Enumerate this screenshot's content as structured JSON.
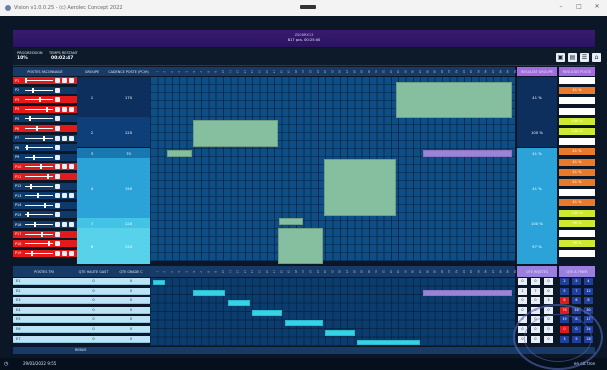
{
  "window": {
    "title": "Vision v1.0.0.25 - (c) Aerolec Concept 2022"
  },
  "header": {
    "line1": "Z006RX13",
    "line2": "817 pcs. 00:25:00"
  },
  "progress": {
    "label": "PROGRESSION",
    "value": "10%",
    "remaining_label": "TEMPS RESTANT",
    "remaining": "00:02:47"
  },
  "columns": {
    "postes": "POSTES FACONNAGE",
    "groupe": "GROUPE",
    "cadence": "CADENCE POSTE (PC/H)",
    "res_groupe": "RESULTAT GROUPE",
    "res_poste": "RESULTAT POSTE"
  },
  "timeline": [
    "1",
    "2",
    "3",
    "4",
    "5",
    "6",
    "7",
    "8",
    "9",
    "10",
    "11",
    "12",
    "13",
    "14",
    "15",
    "16",
    "17",
    "18",
    "19",
    "20",
    "21",
    "22",
    "23",
    "24",
    "25",
    "26",
    "27",
    "28",
    "29",
    "30",
    "31",
    "32",
    "33",
    "34",
    "35",
    "36",
    "37",
    "38",
    "39",
    "40",
    "41",
    "42",
    "43",
    "44",
    "45",
    "46",
    "47",
    "48",
    "49",
    "50"
  ],
  "postes": [
    "P1",
    "P2",
    "P3",
    "P4",
    "P5",
    "P6",
    "P7",
    "P8",
    "P9",
    "P10",
    "P11",
    "P12",
    "P13",
    "P14",
    "P15",
    "P16",
    "P17",
    "P18",
    "P19"
  ],
  "groups": [
    {
      "n": "1",
      "cad": "170",
      "res": "41 %"
    },
    {
      "n": "2",
      "cad": "120",
      "res": "100 %"
    },
    {
      "n": "3",
      "cad": "70",
      "res": "41 %"
    },
    {
      "n": "4",
      "cad": "150",
      "res": "41 %"
    },
    {
      "n": "7",
      "cad": "120",
      "res": "100 %"
    },
    {
      "n": "6",
      "cad": "120",
      "res": "97 %"
    }
  ],
  "res_postes": [
    "",
    "41 %",
    "",
    "",
    "100 %",
    "100 %",
    "",
    "41 %",
    "41 %",
    "41 %",
    "41 %",
    "",
    "41 %",
    "100 %",
    "96 %",
    "",
    "98 %",
    ""
  ],
  "tri": {
    "head": "POSTES TRI",
    "q1": "QTE HAUTE GAST",
    "q2": "QTE GRADE C",
    "rows": [
      [
        "E1",
        "0",
        "0"
      ],
      [
        "E2",
        "0",
        "0"
      ],
      [
        "E3",
        "0",
        "0"
      ],
      [
        "E4",
        "0",
        "0"
      ],
      [
        "E5",
        "0",
        "0"
      ],
      [
        "E6",
        "0",
        "0"
      ],
      [
        "E7",
        "0",
        "0"
      ]
    ]
  },
  "qte_head1": "QTE REJETES",
  "qte_head2": "QTE A TRIER",
  "qte_cells": [
    [
      "0",
      "0",
      "0",
      "2",
      "5",
      "4"
    ],
    [
      "1",
      "7",
      "0",
      "5",
      "7",
      "12"
    ],
    [
      "0",
      "0",
      "3",
      "6",
      "6",
      "8"
    ],
    [
      "0",
      "0",
      "0",
      "76",
      "18",
      "30"
    ],
    [
      "0",
      "0",
      "0",
      "19",
      "8",
      "17"
    ],
    [
      "0",
      "0",
      "0",
      "0",
      "0",
      "24"
    ],
    [
      "0",
      "0",
      "0",
      "3",
      "5",
      "28"
    ]
  ],
  "footer": {
    "label": "REBUS"
  },
  "status": {
    "date": "29/03/2022 9:55",
    "right": "en att tron"
  }
}
